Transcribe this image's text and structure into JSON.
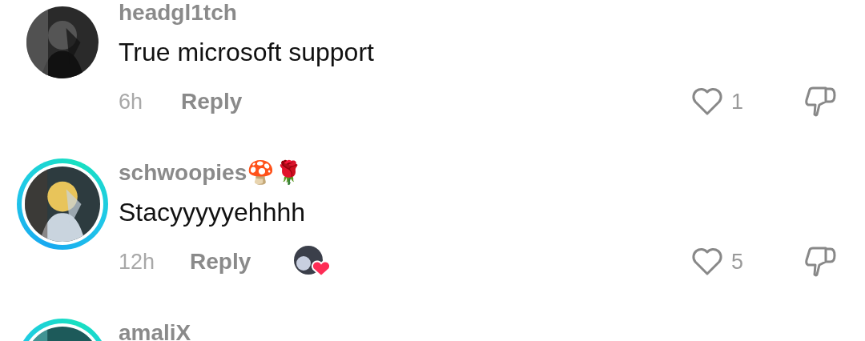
{
  "comments": [
    {
      "username": "headgl1tch",
      "text": "True microsoft support",
      "time": "6h",
      "reply_label": "Reply",
      "likes": "1",
      "story_ring": false,
      "creator_liked": false
    },
    {
      "username": "schwoopies🍄🌹",
      "text": "Stacyyyyyehhhh",
      "time": "12h",
      "reply_label": "Reply",
      "likes": "5",
      "story_ring": true,
      "creator_liked": true
    },
    {
      "username": "amaliX",
      "story_ring": true
    }
  ]
}
